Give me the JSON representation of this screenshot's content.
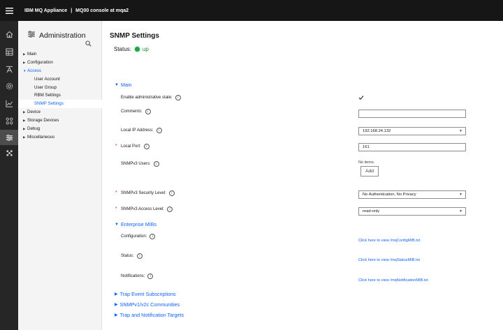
{
  "header": {
    "product": "IBM MQ Appliance",
    "separator": "|",
    "console": "MQ00 console at mqa2"
  },
  "rail": {
    "icons": [
      "home-icon",
      "dashboard-icon",
      "queue-manager-icon",
      "settings-icon",
      "chart-icon",
      "network-icon",
      "administration-icon",
      "tree-icon"
    ],
    "active": "administration-icon"
  },
  "sidebar": {
    "title": "Administration",
    "items": [
      {
        "label": "Main"
      },
      {
        "label": "Configuration"
      },
      {
        "label": "Access"
      },
      {
        "label": "User Account"
      },
      {
        "label": "User Group"
      },
      {
        "label": "RBM Settings"
      },
      {
        "label": "SNMP Settings"
      },
      {
        "label": "Device"
      },
      {
        "label": "Storage Devices"
      },
      {
        "label": "Debug"
      },
      {
        "label": "Miscellaneous"
      }
    ]
  },
  "page": {
    "title": "SNMP Settings",
    "status_label": "Status:",
    "status_value": "up"
  },
  "sections": {
    "main": "Main",
    "enterprise_mibs": "Enterprise MIBs",
    "trap_event": "Trap Event Subscriptions",
    "communities": "SNMPv1/v2c Communities",
    "targets": "Trap and Notification Targets"
  },
  "form": {
    "enable_admin_state": {
      "label": "Enable administrative state:",
      "checked": true
    },
    "comments": {
      "label": "Comments:",
      "value": ""
    },
    "local_ip": {
      "label": "Local IP Address:",
      "value": "192.168.24.132"
    },
    "local_port": {
      "label": "Local Port:",
      "value": "161"
    },
    "snmpv3_users": {
      "label": "SNMPv3 Users:",
      "empty_text": "No items.",
      "add_label": "Add"
    },
    "security_level": {
      "label": "SNMPv3 Security Level:",
      "value": "No Authentication, No Privacy"
    },
    "access_level": {
      "label": "SNMPv3 Access Level:",
      "value": "read-only"
    }
  },
  "mibs": {
    "configuration": {
      "label": "Configuration:",
      "link": "Click here to view /mqConfigMIB.txt"
    },
    "status": {
      "label": "Status:",
      "link": "Click here to view /mqStatusMIB.txt"
    },
    "notifications": {
      "label": "Notifications:",
      "link": "Click here to view /mqNotificationMIB.txt"
    }
  },
  "colors": {
    "accent": "#0f62fe",
    "topbar": "#161616",
    "rail": "#262626",
    "status_ok": "#24a148",
    "required": "#da1e28"
  }
}
